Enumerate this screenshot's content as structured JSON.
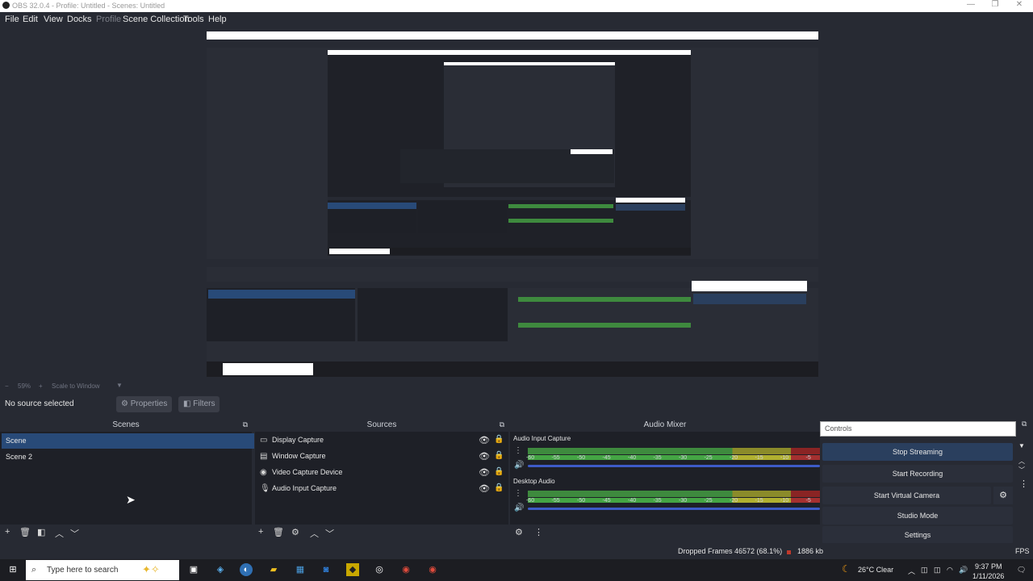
{
  "titlebar": {
    "title": "OBS 32.0.4 - Profile: Untitled - Scenes: Untitled",
    "minimize": "—",
    "maximize": "❐",
    "close": "✕"
  },
  "menu": [
    "File",
    "Edit",
    "View",
    "Docks",
    "Profile",
    "Scene Collection",
    "Tools",
    "Help"
  ],
  "zoom": {
    "level": "59%",
    "scale_label": "Scale to Window"
  },
  "context": {
    "status": "No source selected",
    "properties": "Properties",
    "filters": "Filters"
  },
  "docks": {
    "scenes_title": "Scenes",
    "sources_title": "Sources",
    "mixer_title": "Audio Mixer"
  },
  "scenes": [
    "Scene",
    "Scene 2"
  ],
  "sources": [
    {
      "label": "Display Capture",
      "icon": "monitor-icon"
    },
    {
      "label": "Window Capture",
      "icon": "window-icon"
    },
    {
      "label": "Video Capture Device",
      "icon": "camera-icon"
    },
    {
      "label": "Audio Input Capture",
      "icon": "microphone-icon"
    }
  ],
  "mixer": {
    "channels": [
      {
        "name": "Audio Input Capture",
        "value": "0"
      },
      {
        "name": "Desktop Audio",
        "value": "0"
      }
    ],
    "ticks": [
      "-60",
      "-55",
      "-50",
      "-45",
      "-40",
      "-35",
      "-30",
      "-25",
      "-20",
      "-15",
      "-10",
      "-5"
    ]
  },
  "controls": {
    "title": "Controls",
    "stop_streaming": "Stop Streaming",
    "start_recording": "Start Recording",
    "start_virtual_camera": "Start Virtual Camera",
    "studio_mode": "Studio Mode",
    "settings": "Settings"
  },
  "status": {
    "dropped_frames": "Dropped Frames 46572 (68.1%)",
    "bitrate": "1886 kb",
    "fps": "FPS"
  },
  "taskbar": {
    "search_placeholder": "Type here to search",
    "weather": "26°C  Clear",
    "time": "9:37 PM",
    "date": "1/11/2026"
  },
  "colors": {
    "accent": "#284a78",
    "stream_active": "#2a3f5e",
    "meter_green": "#3e8a3e",
    "meter_yellow": "#8b8b2a",
    "meter_red": "#8a2424"
  }
}
